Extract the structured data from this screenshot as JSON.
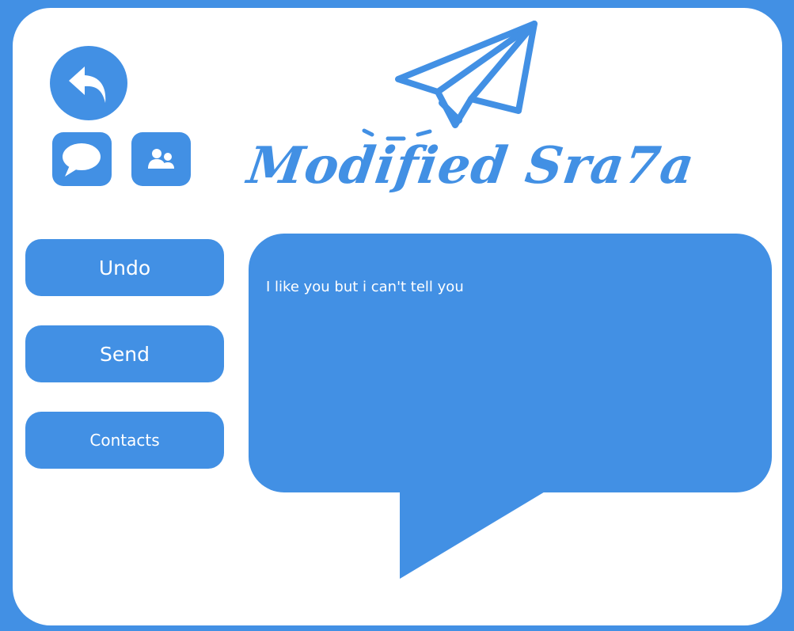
{
  "app": {
    "title": "Modified Sra7a"
  },
  "colors": {
    "accent": "#4290e4",
    "panel": "#ffffff",
    "text_on_accent": "#ffffff"
  },
  "toolbar": {
    "back_icon": "reply-arrow-icon",
    "messages_icon": "chat-bubble-icon",
    "contacts_icon": "people-icon"
  },
  "logo": {
    "icon": "paper-plane-icon"
  },
  "buttons": {
    "undo_label": "Undo",
    "send_label": "Send",
    "contacts_label": "Contacts"
  },
  "message": {
    "text": "I like you but i can't tell you"
  }
}
